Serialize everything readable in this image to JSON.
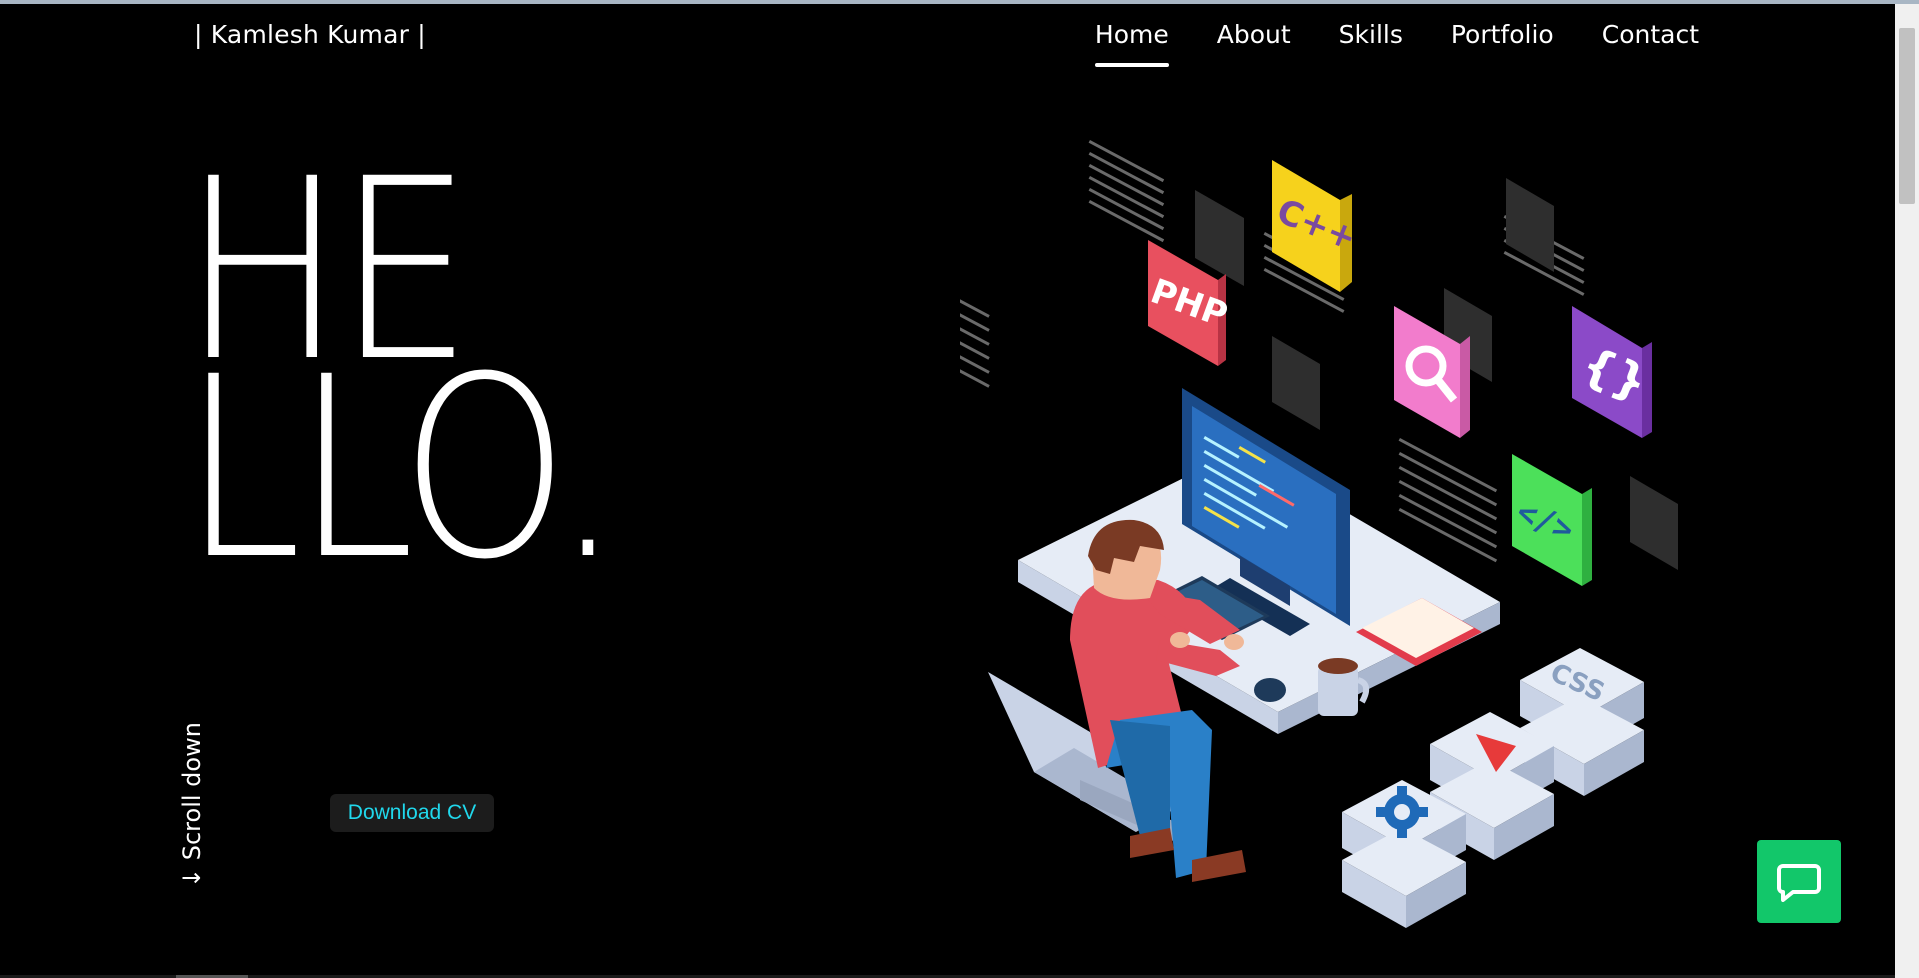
{
  "brand": "| Kamlesh Kumar |",
  "nav": {
    "items": [
      {
        "label": "Home",
        "active": true
      },
      {
        "label": "About",
        "active": false
      },
      {
        "label": "Skills",
        "active": false
      },
      {
        "label": "Portfolio",
        "active": false
      },
      {
        "label": "Contact",
        "active": false
      }
    ]
  },
  "hero": {
    "line1": "HE",
    "line2": "LLO",
    "dot": "."
  },
  "scroll_down": "↓ Scroll down",
  "download_cv": "Download CV",
  "illustration": {
    "tiles": {
      "php": "PHP",
      "cpp": "C++",
      "braces": "{}",
      "code": "</>",
      "css": "CSS"
    }
  },
  "colors": {
    "background": "#000000",
    "accent": "#20d8ec",
    "chat": "#12c76a"
  }
}
